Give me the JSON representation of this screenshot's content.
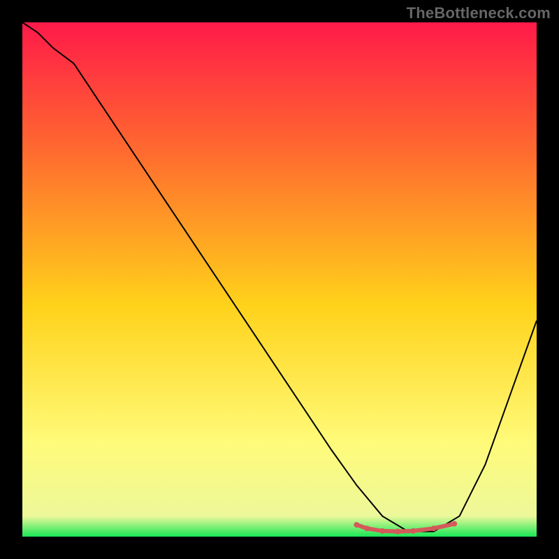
{
  "watermark": "TheBottleneck.com",
  "chart_data": {
    "type": "line",
    "title": "",
    "xlabel": "",
    "ylabel": "",
    "xlim": [
      0,
      100
    ],
    "ylim": [
      0,
      100
    ],
    "grid": false,
    "background_gradient": {
      "stops": [
        {
          "offset": 0.0,
          "color": "#ff1a49"
        },
        {
          "offset": 0.25,
          "color": "#ff6a2f"
        },
        {
          "offset": 0.55,
          "color": "#ffd21a"
        },
        {
          "offset": 0.82,
          "color": "#fffb7a"
        },
        {
          "offset": 0.96,
          "color": "#edf89a"
        },
        {
          "offset": 1.0,
          "color": "#18e856"
        }
      ]
    },
    "series": [
      {
        "name": "curve",
        "stroke": "#000000",
        "stroke_width": 2,
        "x": [
          0,
          3,
          6,
          10,
          20,
          30,
          40,
          50,
          60,
          65,
          70,
          75,
          80,
          85,
          90,
          95,
          100
        ],
        "y": [
          100,
          98,
          95,
          92,
          77,
          62,
          47,
          32,
          17,
          10,
          4,
          1,
          1,
          4,
          14,
          28,
          42
        ]
      },
      {
        "name": "valley-dots",
        "stroke": "#d45a5a",
        "stroke_width": 6,
        "marker": "circle",
        "marker_size": 6,
        "x": [
          65,
          67,
          70,
          73,
          76,
          80,
          84
        ],
        "y": [
          2.3,
          1.6,
          1.1,
          1.0,
          1.1,
          1.6,
          2.5
        ]
      }
    ]
  }
}
